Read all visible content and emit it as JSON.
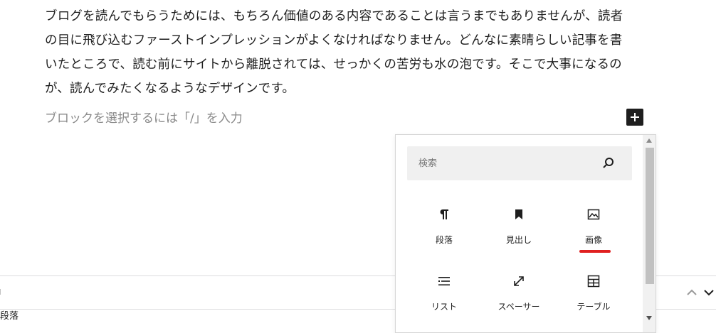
{
  "editor": {
    "paragraph_lines": [
      "ブログを読んでもらうためには、もちろん価値のある内容であることは言うまでもありませんが、読者",
      "の目に飛び込むファーストインプレッションがよくなければなりません。どんなに素晴らしい記事を書",
      "いたところで、読む前にサイトから離脱されては、せっかくの苦労も水の泡です。そこで大事になるの",
      "が、読んでみたくなるようなデザインです。"
    ],
    "block_placeholder": "ブロックを選択するには「/」を入力",
    "inserter_toggle_icon": "plus-icon"
  },
  "inserter": {
    "search": {
      "placeholder": "検索",
      "value": "",
      "icon": "search-icon"
    },
    "blocks": [
      {
        "label": "段落",
        "icon": "paragraph-icon"
      },
      {
        "label": "見出し",
        "icon": "bookmark-icon"
      },
      {
        "label": "画像",
        "icon": "image-icon",
        "highlighted": true
      },
      {
        "label": "リスト",
        "icon": "list-icon"
      },
      {
        "label": "スペーサー",
        "icon": "resize-icon"
      },
      {
        "label": "テーブル",
        "icon": "table-icon"
      }
    ],
    "highlight_color": "#e02020"
  },
  "footer": {
    "breadcrumb": "段落"
  },
  "colors": {
    "text": "#1e1e1e",
    "placeholder": "#8a8a8a",
    "search_bg": "#f0f0f0",
    "scroll_thumb": "#c1c1c1"
  }
}
